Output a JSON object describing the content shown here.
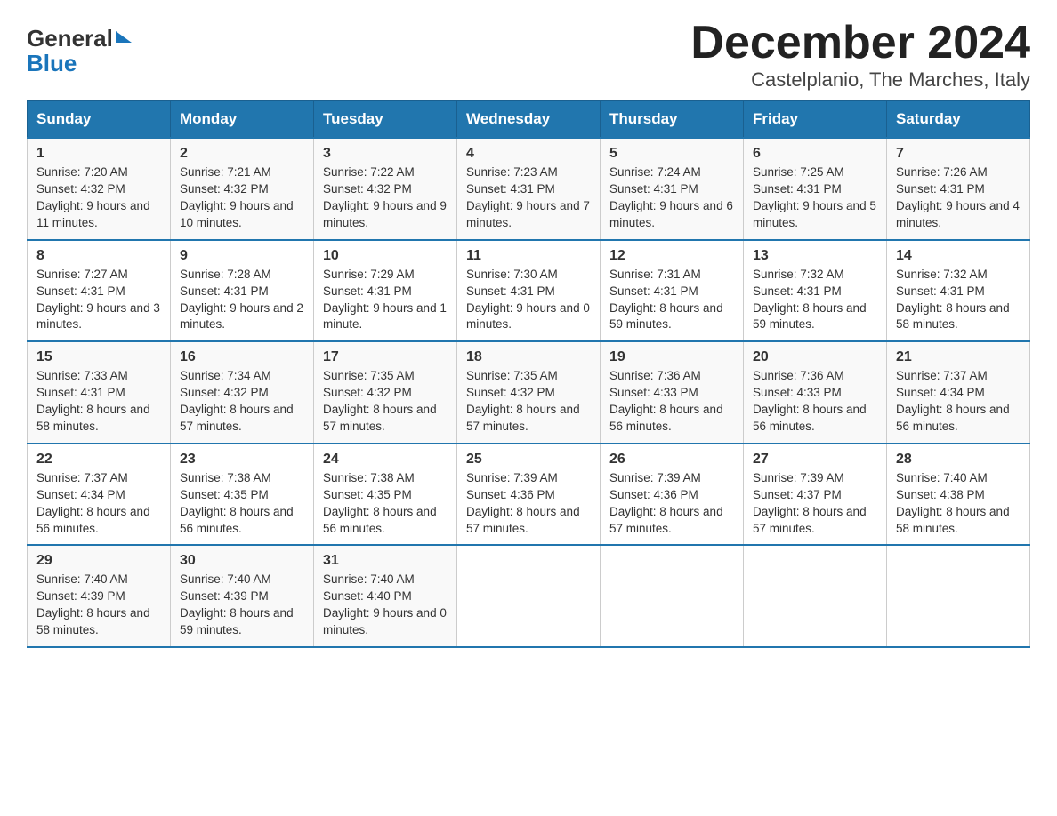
{
  "header": {
    "logo_general": "General",
    "logo_blue": "Blue",
    "title": "December 2024",
    "subtitle": "Castelplanio, The Marches, Italy"
  },
  "days_of_week": [
    "Sunday",
    "Monday",
    "Tuesday",
    "Wednesday",
    "Thursday",
    "Friday",
    "Saturday"
  ],
  "weeks": [
    [
      {
        "day": "1",
        "sunrise": "7:20 AM",
        "sunset": "4:32 PM",
        "daylight": "9 hours and 11 minutes."
      },
      {
        "day": "2",
        "sunrise": "7:21 AM",
        "sunset": "4:32 PM",
        "daylight": "9 hours and 10 minutes."
      },
      {
        "day": "3",
        "sunrise": "7:22 AM",
        "sunset": "4:32 PM",
        "daylight": "9 hours and 9 minutes."
      },
      {
        "day": "4",
        "sunrise": "7:23 AM",
        "sunset": "4:31 PM",
        "daylight": "9 hours and 7 minutes."
      },
      {
        "day": "5",
        "sunrise": "7:24 AM",
        "sunset": "4:31 PM",
        "daylight": "9 hours and 6 minutes."
      },
      {
        "day": "6",
        "sunrise": "7:25 AM",
        "sunset": "4:31 PM",
        "daylight": "9 hours and 5 minutes."
      },
      {
        "day": "7",
        "sunrise": "7:26 AM",
        "sunset": "4:31 PM",
        "daylight": "9 hours and 4 minutes."
      }
    ],
    [
      {
        "day": "8",
        "sunrise": "7:27 AM",
        "sunset": "4:31 PM",
        "daylight": "9 hours and 3 minutes."
      },
      {
        "day": "9",
        "sunrise": "7:28 AM",
        "sunset": "4:31 PM",
        "daylight": "9 hours and 2 minutes."
      },
      {
        "day": "10",
        "sunrise": "7:29 AM",
        "sunset": "4:31 PM",
        "daylight": "9 hours and 1 minute."
      },
      {
        "day": "11",
        "sunrise": "7:30 AM",
        "sunset": "4:31 PM",
        "daylight": "9 hours and 0 minutes."
      },
      {
        "day": "12",
        "sunrise": "7:31 AM",
        "sunset": "4:31 PM",
        "daylight": "8 hours and 59 minutes."
      },
      {
        "day": "13",
        "sunrise": "7:32 AM",
        "sunset": "4:31 PM",
        "daylight": "8 hours and 59 minutes."
      },
      {
        "day": "14",
        "sunrise": "7:32 AM",
        "sunset": "4:31 PM",
        "daylight": "8 hours and 58 minutes."
      }
    ],
    [
      {
        "day": "15",
        "sunrise": "7:33 AM",
        "sunset": "4:31 PM",
        "daylight": "8 hours and 58 minutes."
      },
      {
        "day": "16",
        "sunrise": "7:34 AM",
        "sunset": "4:32 PM",
        "daylight": "8 hours and 57 minutes."
      },
      {
        "day": "17",
        "sunrise": "7:35 AM",
        "sunset": "4:32 PM",
        "daylight": "8 hours and 57 minutes."
      },
      {
        "day": "18",
        "sunrise": "7:35 AM",
        "sunset": "4:32 PM",
        "daylight": "8 hours and 57 minutes."
      },
      {
        "day": "19",
        "sunrise": "7:36 AM",
        "sunset": "4:33 PM",
        "daylight": "8 hours and 56 minutes."
      },
      {
        "day": "20",
        "sunrise": "7:36 AM",
        "sunset": "4:33 PM",
        "daylight": "8 hours and 56 minutes."
      },
      {
        "day": "21",
        "sunrise": "7:37 AM",
        "sunset": "4:34 PM",
        "daylight": "8 hours and 56 minutes."
      }
    ],
    [
      {
        "day": "22",
        "sunrise": "7:37 AM",
        "sunset": "4:34 PM",
        "daylight": "8 hours and 56 minutes."
      },
      {
        "day": "23",
        "sunrise": "7:38 AM",
        "sunset": "4:35 PM",
        "daylight": "8 hours and 56 minutes."
      },
      {
        "day": "24",
        "sunrise": "7:38 AM",
        "sunset": "4:35 PM",
        "daylight": "8 hours and 56 minutes."
      },
      {
        "day": "25",
        "sunrise": "7:39 AM",
        "sunset": "4:36 PM",
        "daylight": "8 hours and 57 minutes."
      },
      {
        "day": "26",
        "sunrise": "7:39 AM",
        "sunset": "4:36 PM",
        "daylight": "8 hours and 57 minutes."
      },
      {
        "day": "27",
        "sunrise": "7:39 AM",
        "sunset": "4:37 PM",
        "daylight": "8 hours and 57 minutes."
      },
      {
        "day": "28",
        "sunrise": "7:40 AM",
        "sunset": "4:38 PM",
        "daylight": "8 hours and 58 minutes."
      }
    ],
    [
      {
        "day": "29",
        "sunrise": "7:40 AM",
        "sunset": "4:39 PM",
        "daylight": "8 hours and 58 minutes."
      },
      {
        "day": "30",
        "sunrise": "7:40 AM",
        "sunset": "4:39 PM",
        "daylight": "8 hours and 59 minutes."
      },
      {
        "day": "31",
        "sunrise": "7:40 AM",
        "sunset": "4:40 PM",
        "daylight": "9 hours and 0 minutes."
      },
      null,
      null,
      null,
      null
    ]
  ]
}
